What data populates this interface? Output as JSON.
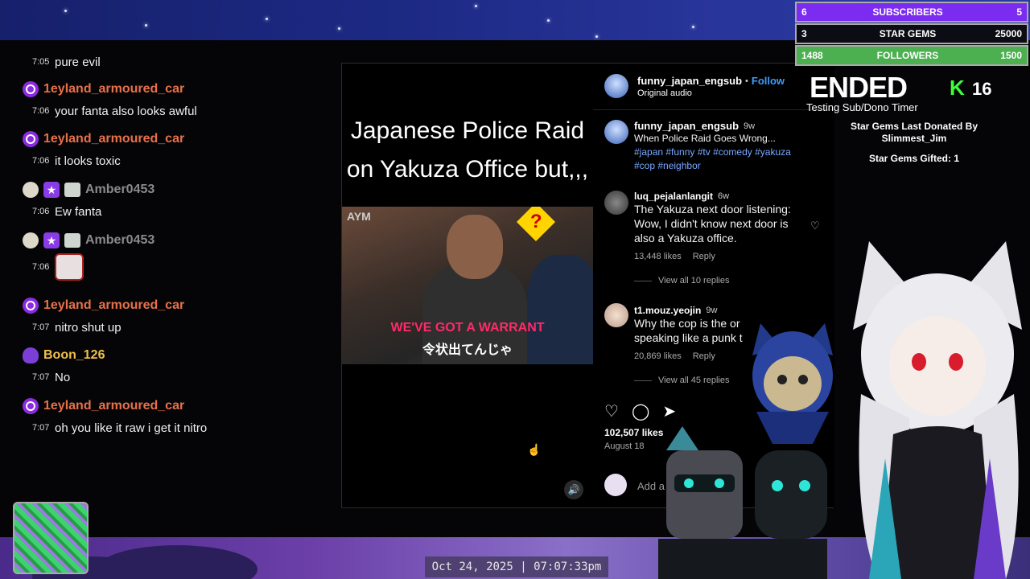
{
  "chat": {
    "messages": [
      {
        "user": "",
        "time": "7:05",
        "text": "pure evil"
      },
      {
        "user": "1eyland_armoured_car",
        "user_color": "#e8714a",
        "time": "7:06",
        "text": "your fanta also looks awful"
      },
      {
        "user": "1eyland_armoured_car",
        "user_color": "#e8714a",
        "time": "7:06",
        "text": "it looks toxic"
      },
      {
        "user": "Amber0453",
        "user_color": "#8a8a8a",
        "time": "7:06",
        "text": "Ew fanta"
      },
      {
        "user": "Amber0453",
        "user_color": "#8a8a8a",
        "time": "7:06",
        "text": ""
      },
      {
        "user": "1eyland_armoured_car",
        "user_color": "#e8714a",
        "time": "7:07",
        "text": "nitro shut up"
      },
      {
        "user": "Boon_126",
        "user_color": "#f0c04a",
        "time": "7:07",
        "text": "No"
      },
      {
        "user": "1eyland_armoured_car",
        "user_color": "#e8714a",
        "time": "7:07",
        "text": "oh you like it raw i get it nitro"
      }
    ]
  },
  "video": {
    "title_line1": "Japanese Police Raid",
    "title_line2": "on Yakuza Office but,,,",
    "logo": "AYM",
    "subtitle_en": "WE'VE GOT A WARRANT",
    "subtitle_jp": "令状出てんじゃ"
  },
  "post": {
    "author": "funny_japan_engsub",
    "follow_label": "Follow",
    "audio": "Original audio",
    "caption_age": "9w",
    "caption_text": "When Police Raid Goes Wrong...",
    "tags_line1": "#japan #funny #tv #comedy #yakuza",
    "tags_line2": "#cop #neighbor",
    "comments": [
      {
        "user": "luq_pejalanlangit",
        "age": "6w",
        "line1": "The Yakuza next door listening:",
        "line2": "Wow, I didn't know next door is",
        "line3": "also a Yakuza office.",
        "likes": "13,448 likes",
        "reply": "Reply",
        "view_all": "View all 10 replies"
      },
      {
        "user": "t1.mouz.yeojin",
        "age": "9w",
        "line1": "Why the cop is the or",
        "line2": "speaking like a punk t",
        "likes": "20,869 likes",
        "reply": "Reply",
        "view_all": "View all 45 replies"
      }
    ],
    "likes_total": "102,507 likes",
    "date": "August 18",
    "add_comment": "Add a"
  },
  "goals": [
    {
      "left": "6",
      "label": "SUBSCRIBERS",
      "right": "5",
      "color": "#7b2cf0"
    },
    {
      "left": "3",
      "label": "STAR GEMS",
      "right": "25000",
      "color": "#0c0c14"
    },
    {
      "left": "1488",
      "label": "FOLLOWERS",
      "right": "1500",
      "color": "#4caf50"
    }
  ],
  "timer": {
    "status": "ENDED",
    "kick_count": "16",
    "subtitle": "Testing Sub/Dono Timer",
    "gems_line1": "Star Gems Last Donated By",
    "gems_line2": "Slimmest_Jim",
    "gems_gifted": "Star Gems Gifted: 1"
  },
  "clock": "Oct 24, 2025 | 07:07:33pm",
  "colors": {
    "accent_purple": "#8a2be2",
    "kick_green": "#3bff3b",
    "link_blue": "#3d9bff"
  }
}
